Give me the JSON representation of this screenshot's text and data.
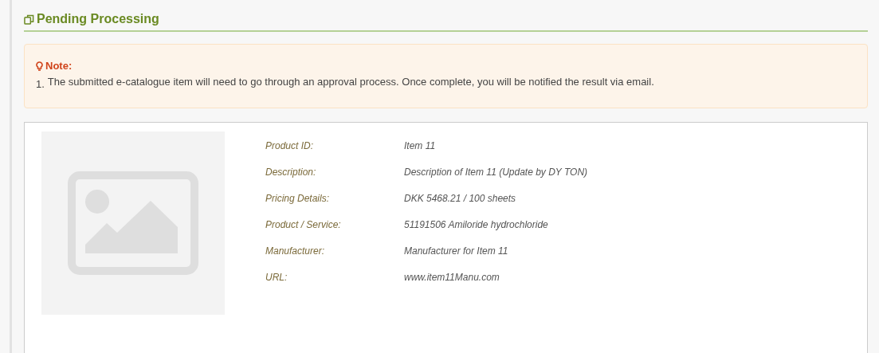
{
  "section_title": "Pending Processing",
  "note": {
    "heading": "Note:",
    "items": [
      {
        "number": "1.",
        "text": "The submitted e-catalogue item will need to go through an approval process. Once complete, you will be notified the result via email."
      }
    ]
  },
  "details": [
    {
      "label": "Product ID:",
      "value": "Item 11"
    },
    {
      "label": "Description:",
      "value": "Description of Item 11 (Update by DY TON)"
    },
    {
      "label": "Pricing Details:",
      "value": "DKK 5468.21 / 100 sheets"
    },
    {
      "label": "Product / Service:",
      "value": "51191506 Amiloride hydrochloride"
    },
    {
      "label": "Manufacturer:",
      "value": "Manufacturer for Item 11"
    },
    {
      "label": "URL:",
      "value": "www.item11Manu.com"
    }
  ]
}
